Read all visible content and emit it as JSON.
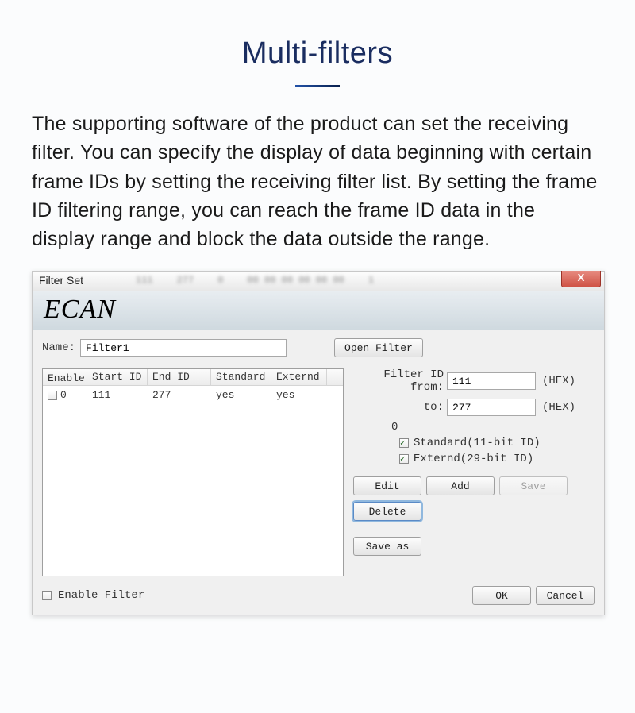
{
  "heading": "Multi-filters",
  "description": "The supporting software of the product can set the receiving filter. You can specify the display of data beginning with certain frame IDs by setting the receiving filter list. By setting the frame ID filtering range, you can reach the frame ID data in the display range and block the data outside the range.",
  "dialog": {
    "title": "Filter Set",
    "banner_logo": "ECAN",
    "name_label": "Name:",
    "name_value": "Filter1",
    "open_filter_btn": "Open Filter",
    "grid": {
      "columns": {
        "enable": "Enable",
        "start_id": "Start ID",
        "end_id": "End ID",
        "standard": "Standard",
        "externd": "Externd"
      },
      "rows": [
        {
          "enable_checked": false,
          "index": "0",
          "start_id": "111",
          "end_id": "277",
          "standard": "yes",
          "externd": "yes"
        }
      ]
    },
    "filter_panel": {
      "from_label": "Filter ID from:",
      "from_value": "111",
      "to_label": "to:",
      "to_value": "277",
      "hex_suffix": "(HEX)",
      "index_line": "0",
      "standard_label": "Standard(11-bit ID)",
      "standard_checked": true,
      "externd_label": "Externd(29-bit ID)",
      "externd_checked": true
    },
    "buttons": {
      "edit": "Edit",
      "add": "Add",
      "save": "Save",
      "delete": "Delete",
      "save_as": "Save as"
    },
    "bottom": {
      "enable_filter_label": "Enable Filter",
      "enable_filter_checked": false,
      "ok": "OK",
      "cancel": "Cancel"
    }
  }
}
